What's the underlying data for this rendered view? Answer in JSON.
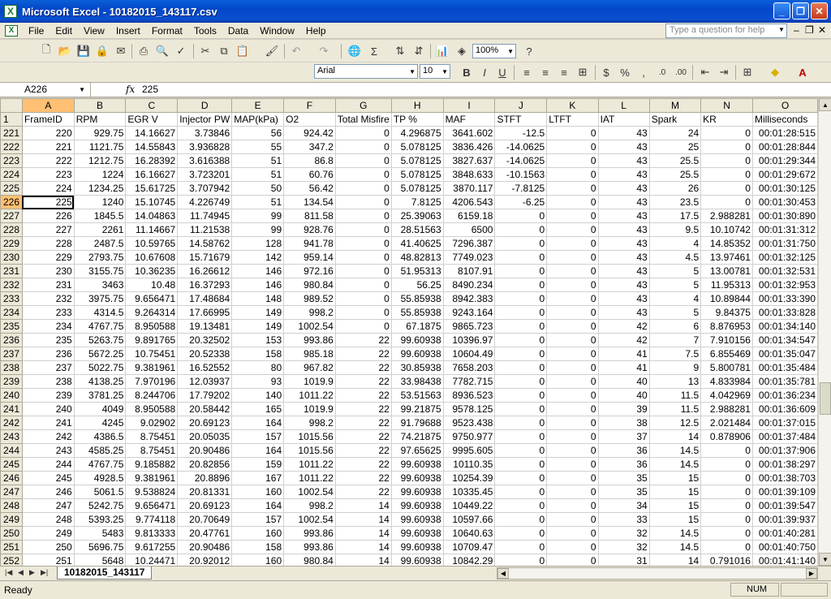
{
  "window": {
    "title": "Microsoft Excel - 10182015_143117.csv",
    "app_icon": "X"
  },
  "menu": {
    "items": [
      "File",
      "Edit",
      "View",
      "Insert",
      "Format",
      "Tools",
      "Data",
      "Window",
      "Help"
    ],
    "help_placeholder": "Type a question for help"
  },
  "toolbar": {
    "zoom": "100%",
    "font_name": "Arial",
    "font_size": "10"
  },
  "formula_bar": {
    "name_box": "A226",
    "fx": "fx",
    "value": "225"
  },
  "sheet": {
    "column_letters": [
      "A",
      "B",
      "C",
      "D",
      "E",
      "F",
      "G",
      "H",
      "I",
      "J",
      "K",
      "L",
      "M",
      "N",
      "O"
    ],
    "active_column": "A",
    "active_row": "226",
    "header_row": {
      "row_number": "1",
      "cells": [
        "FrameID",
        "RPM",
        "EGR V",
        "Injector PW",
        "MAP(kPa)",
        "O2",
        "Total Misfire",
        "TP %",
        "MAF",
        "STFT",
        "LTFT",
        "IAT",
        "Spark",
        "KR",
        "Milliseconds"
      ]
    },
    "rows": [
      [
        "221",
        "220",
        "929.75",
        "14.16627",
        "3.73846",
        "56",
        "924.42",
        "0",
        "4.296875",
        "3641.602",
        "-12.5",
        "0",
        "43",
        "24",
        "0",
        "00:01:28:515"
      ],
      [
        "222",
        "221",
        "1121.75",
        "14.55843",
        "3.936828",
        "55",
        "347.2",
        "0",
        "5.078125",
        "3836.426",
        "-14.0625",
        "0",
        "43",
        "25",
        "0",
        "00:01:28:844"
      ],
      [
        "223",
        "222",
        "1212.75",
        "16.28392",
        "3.616388",
        "51",
        "86.8",
        "0",
        "5.078125",
        "3827.637",
        "-14.0625",
        "0",
        "43",
        "25.5",
        "0",
        "00:01:29:344"
      ],
      [
        "224",
        "223",
        "1224",
        "16.16627",
        "3.723201",
        "51",
        "60.76",
        "0",
        "5.078125",
        "3848.633",
        "-10.1563",
        "0",
        "43",
        "25.5",
        "0",
        "00:01:29:672"
      ],
      [
        "225",
        "224",
        "1234.25",
        "15.61725",
        "3.707942",
        "50",
        "56.42",
        "0",
        "5.078125",
        "3870.117",
        "-7.8125",
        "0",
        "43",
        "26",
        "0",
        "00:01:30:125"
      ],
      [
        "226",
        "225",
        "1240",
        "15.10745",
        "4.226749",
        "51",
        "134.54",
        "0",
        "7.8125",
        "4206.543",
        "-6.25",
        "0",
        "43",
        "23.5",
        "0",
        "00:01:30:453"
      ],
      [
        "227",
        "226",
        "1845.5",
        "14.04863",
        "11.74945",
        "99",
        "811.58",
        "0",
        "25.39063",
        "6159.18",
        "0",
        "0",
        "43",
        "17.5",
        "2.988281",
        "00:01:30:890"
      ],
      [
        "228",
        "227",
        "2261",
        "11.14667",
        "11.21538",
        "99",
        "928.76",
        "0",
        "28.51563",
        "6500",
        "0",
        "0",
        "43",
        "9.5",
        "10.10742",
        "00:01:31:312"
      ],
      [
        "229",
        "228",
        "2487.5",
        "10.59765",
        "14.58762",
        "128",
        "941.78",
        "0",
        "41.40625",
        "7296.387",
        "0",
        "0",
        "43",
        "4",
        "14.85352",
        "00:01:31:750"
      ],
      [
        "230",
        "229",
        "2793.75",
        "10.67608",
        "15.71679",
        "142",
        "959.14",
        "0",
        "48.82813",
        "7749.023",
        "0",
        "0",
        "43",
        "4.5",
        "13.97461",
        "00:01:32:125"
      ],
      [
        "231",
        "230",
        "3155.75",
        "10.36235",
        "16.26612",
        "146",
        "972.16",
        "0",
        "51.95313",
        "8107.91",
        "0",
        "0",
        "43",
        "5",
        "13.00781",
        "00:01:32:531"
      ],
      [
        "232",
        "231",
        "3463",
        "10.48",
        "16.37293",
        "146",
        "980.84",
        "0",
        "56.25",
        "8490.234",
        "0",
        "0",
        "43",
        "5",
        "11.95313",
        "00:01:32:953"
      ],
      [
        "233",
        "232",
        "3975.75",
        "9.656471",
        "17.48684",
        "148",
        "989.52",
        "0",
        "55.85938",
        "8942.383",
        "0",
        "0",
        "43",
        "4",
        "10.89844",
        "00:01:33:390"
      ],
      [
        "234",
        "233",
        "4314.5",
        "9.264314",
        "17.66995",
        "149",
        "998.2",
        "0",
        "55.85938",
        "9243.164",
        "0",
        "0",
        "43",
        "5",
        "9.84375",
        "00:01:33:828"
      ],
      [
        "235",
        "234",
        "4767.75",
        "8.950588",
        "19.13481",
        "149",
        "1002.54",
        "0",
        "67.1875",
        "9865.723",
        "0",
        "0",
        "42",
        "6",
        "8.876953",
        "00:01:34:140"
      ],
      [
        "236",
        "235",
        "5263.75",
        "9.891765",
        "20.32502",
        "153",
        "993.86",
        "22",
        "99.60938",
        "10396.97",
        "0",
        "0",
        "42",
        "7",
        "7.910156",
        "00:01:34:547"
      ],
      [
        "237",
        "236",
        "5672.25",
        "10.75451",
        "20.52338",
        "158",
        "985.18",
        "22",
        "99.60938",
        "10604.49",
        "0",
        "0",
        "41",
        "7.5",
        "6.855469",
        "00:01:35:047"
      ],
      [
        "238",
        "237",
        "5022.75",
        "9.381961",
        "16.52552",
        "80",
        "967.82",
        "22",
        "30.85938",
        "7658.203",
        "0",
        "0",
        "41",
        "9",
        "5.800781",
        "00:01:35:484"
      ],
      [
        "239",
        "238",
        "4138.25",
        "7.970196",
        "12.03937",
        "93",
        "1019.9",
        "22",
        "33.98438",
        "7782.715",
        "0",
        "0",
        "40",
        "13",
        "4.833984",
        "00:01:35:781"
      ],
      [
        "240",
        "239",
        "3781.25",
        "8.244706",
        "17.79202",
        "140",
        "1011.22",
        "22",
        "53.51563",
        "8936.523",
        "0",
        "0",
        "40",
        "11.5",
        "4.042969",
        "00:01:36:234"
      ],
      [
        "241",
        "240",
        "4049",
        "8.950588",
        "20.58442",
        "165",
        "1019.9",
        "22",
        "99.21875",
        "9578.125",
        "0",
        "0",
        "39",
        "11.5",
        "2.988281",
        "00:01:36:609"
      ],
      [
        "242",
        "241",
        "4245",
        "9.02902",
        "20.69123",
        "164",
        "998.2",
        "22",
        "91.79688",
        "9523.438",
        "0",
        "0",
        "38",
        "12.5",
        "2.021484",
        "00:01:37:015"
      ],
      [
        "243",
        "242",
        "4386.5",
        "8.75451",
        "20.05035",
        "157",
        "1015.56",
        "22",
        "74.21875",
        "9750.977",
        "0",
        "0",
        "37",
        "14",
        "0.878906",
        "00:01:37:484"
      ],
      [
        "244",
        "243",
        "4585.25",
        "8.75451",
        "20.90486",
        "164",
        "1015.56",
        "22",
        "97.65625",
        "9995.605",
        "0",
        "0",
        "36",
        "14.5",
        "0",
        "00:01:37:906"
      ],
      [
        "245",
        "244",
        "4767.75",
        "9.185882",
        "20.82856",
        "159",
        "1011.22",
        "22",
        "99.60938",
        "10110.35",
        "0",
        "0",
        "36",
        "14.5",
        "0",
        "00:01:38:297"
      ],
      [
        "246",
        "245",
        "4928.5",
        "9.381961",
        "20.8896",
        "167",
        "1011.22",
        "22",
        "99.60938",
        "10254.39",
        "0",
        "0",
        "35",
        "15",
        "0",
        "00:01:38:703"
      ],
      [
        "247",
        "246",
        "5061.5",
        "9.538824",
        "20.81331",
        "160",
        "1002.54",
        "22",
        "99.60938",
        "10335.45",
        "0",
        "0",
        "35",
        "15",
        "0",
        "00:01:39:109"
      ],
      [
        "248",
        "247",
        "5242.75",
        "9.656471",
        "20.69123",
        "164",
        "998.2",
        "14",
        "99.60938",
        "10449.22",
        "0",
        "0",
        "34",
        "15",
        "0",
        "00:01:39:547"
      ],
      [
        "249",
        "248",
        "5393.25",
        "9.774118",
        "20.70649",
        "157",
        "1002.54",
        "14",
        "99.60938",
        "10597.66",
        "0",
        "0",
        "33",
        "15",
        "0",
        "00:01:39:937"
      ],
      [
        "250",
        "249",
        "5483",
        "9.813333",
        "20.47761",
        "160",
        "993.86",
        "14",
        "99.60938",
        "10640.63",
        "0",
        "0",
        "32",
        "14.5",
        "0",
        "00:01:40:281"
      ],
      [
        "251",
        "250",
        "5696.75",
        "9.617255",
        "20.90486",
        "158",
        "993.86",
        "14",
        "99.60938",
        "10709.47",
        "0",
        "0",
        "32",
        "14.5",
        "0",
        "00:01:40:750"
      ],
      [
        "252",
        "251",
        "5648",
        "10.24471",
        "20.92012",
        "160",
        "980.84",
        "14",
        "99.60938",
        "10842.29",
        "0",
        "0",
        "31",
        "14",
        "0.791016",
        "00:01:41:140"
      ]
    ]
  },
  "tabs": {
    "sheet_name": "10182015_143117"
  },
  "status": {
    "left": "Ready",
    "num": "NUM"
  }
}
